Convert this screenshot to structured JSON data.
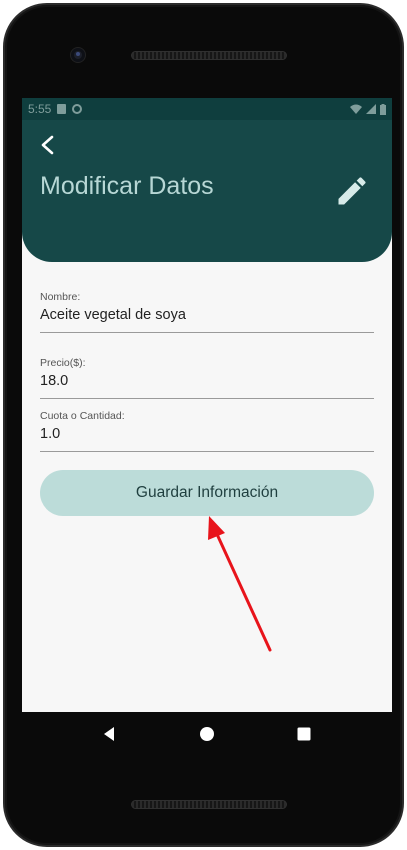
{
  "status_bar": {
    "time": "5:55",
    "icons_left": [
      "sd-card-icon",
      "sync-icon"
    ],
    "icons_right": [
      "wifi-icon",
      "signal-icon",
      "battery-icon"
    ]
  },
  "header": {
    "title": "Modificar Datos",
    "back_icon": "chevron-left-icon",
    "edit_icon": "pencil-icon",
    "background": "#164848",
    "title_color": "#b7d7d5"
  },
  "form": {
    "fields": [
      {
        "label": "Nombre:",
        "value": "Aceite vegetal de soya"
      },
      {
        "label": "Precio($):",
        "value": "18.0"
      },
      {
        "label": "Cuota o Cantidad:",
        "value": "1.0"
      }
    ],
    "save_label": "Guardar Información",
    "button_color": "#bcdcd9"
  },
  "annotation": {
    "type": "arrow-icon",
    "color": "#e8141b"
  },
  "navigation_bar": {
    "buttons": [
      "back-triangle-icon",
      "home-circle-icon",
      "recents-square-icon"
    ]
  }
}
